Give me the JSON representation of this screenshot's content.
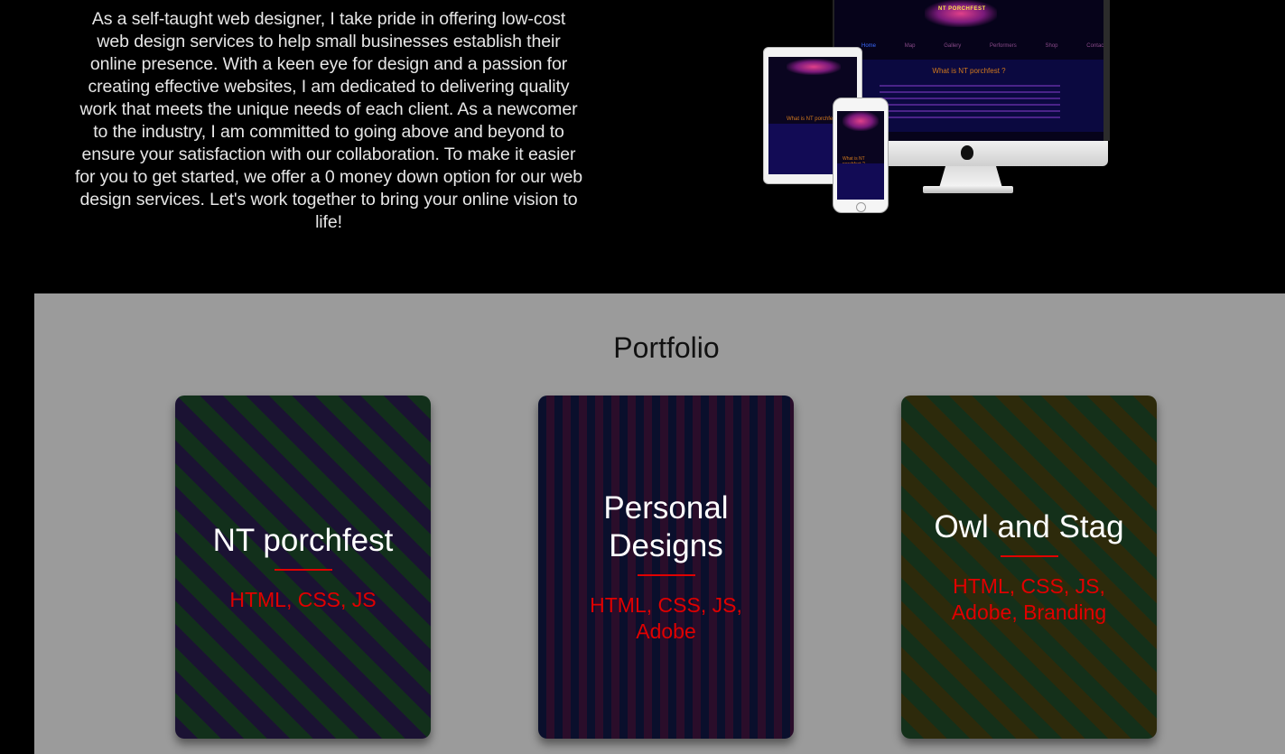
{
  "about": {
    "paragraph": "As a self-taught web designer, I take pride in offering low-cost web design services to help small businesses establish their online presence. With a keen eye for design and a passion for creating effective websites, I am dedicated to delivering quality work that meets the unique needs of each client. As a newcomer to the industry, I am committed to going above and beyond to ensure your satisfaction with our collaboration. To make it easier for you to get started, we offer a 0 money down option for our web design services. Let's work together to bring your online vision to life!"
  },
  "mockup": {
    "logo_text": "NT PORCHFEST",
    "nav": [
      "Home",
      "Map",
      "Gallery",
      "Performers",
      "Shop",
      "Contact"
    ],
    "heading": "What is NT porchfest ?"
  },
  "portfolio": {
    "title": "Portfolio",
    "cards": [
      {
        "title": "NT porchfest",
        "tags": "HTML, CSS, JS"
      },
      {
        "title": "Personal Designs",
        "tags": "HTML, CSS, JS, Adobe"
      },
      {
        "title": "Owl and Stag",
        "tags": "HTML, CSS, JS, Adobe, Branding"
      }
    ]
  },
  "colors": {
    "background": "#000000",
    "portfolio_bg": "#9b9b9b",
    "accent_red": "#e00000"
  }
}
